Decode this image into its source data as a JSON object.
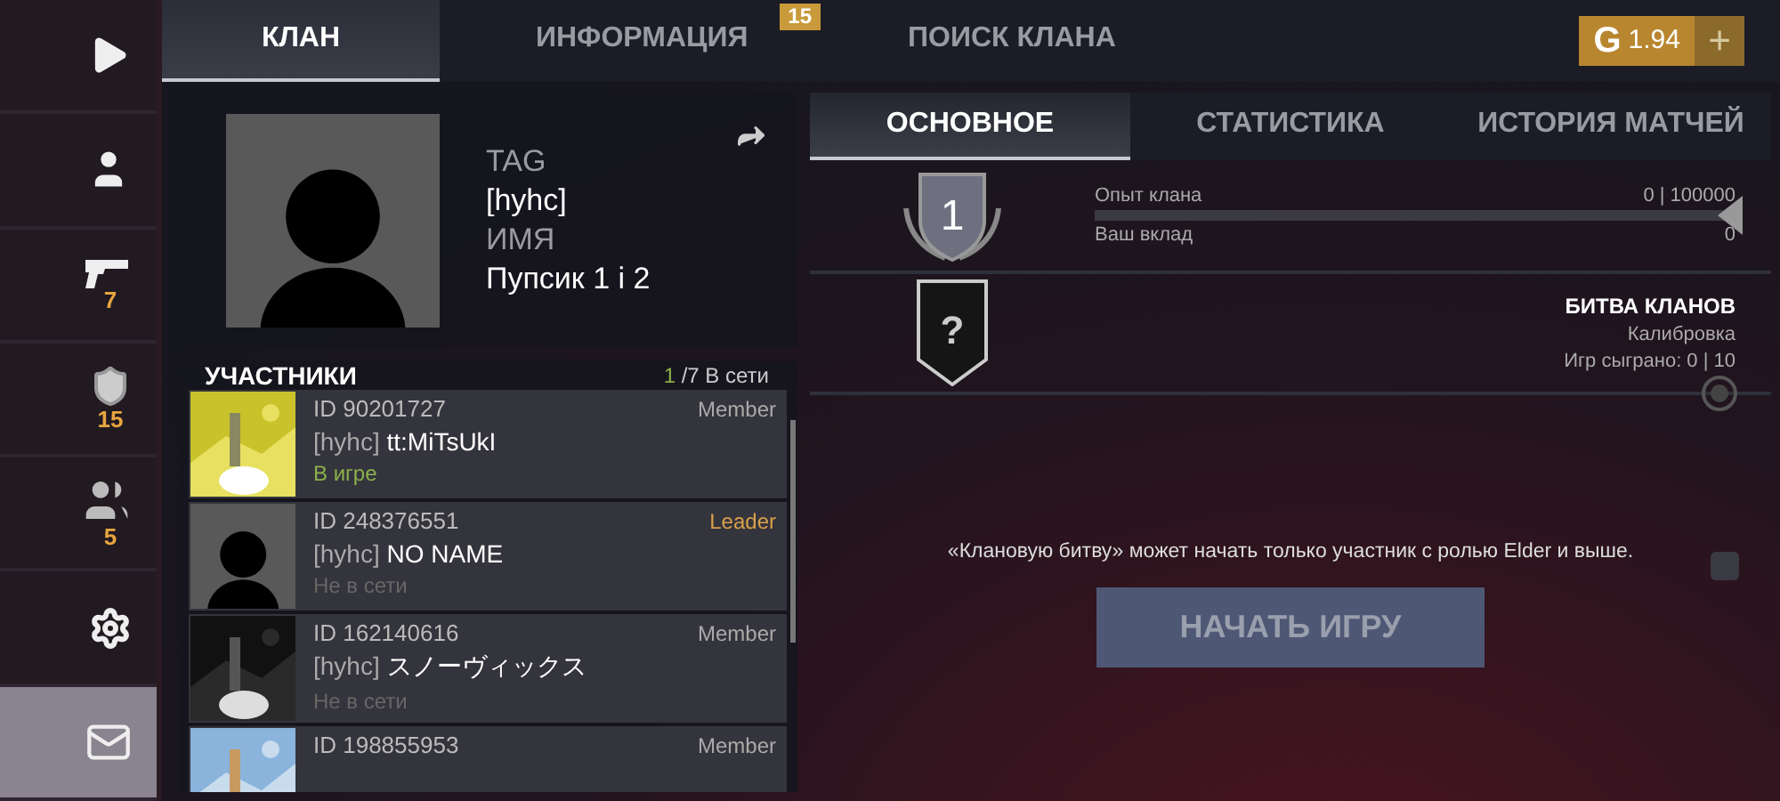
{
  "sidebar": {
    "items": [
      {
        "kind": "play",
        "selected": false
      },
      {
        "kind": "profile",
        "selected": false
      },
      {
        "kind": "pistol",
        "count": "7",
        "selected": false
      },
      {
        "kind": "shield",
        "count": "15",
        "selected": false
      },
      {
        "kind": "group",
        "count": "5",
        "selected": false
      },
      {
        "kind": "settings",
        "selected": false
      },
      {
        "kind": "mail",
        "selected": true
      }
    ]
  },
  "tabs": [
    {
      "label": "КЛАН",
      "selected": true
    },
    {
      "label": "ИНФОРМАЦИЯ",
      "selected": false,
      "badge": "15"
    },
    {
      "label": "ПОИСК КЛАНА",
      "selected": false
    }
  ],
  "currency": {
    "symbol": "G",
    "amount": "1.94",
    "add": "+"
  },
  "clan": {
    "tag_label": "TAG",
    "tag": "[hyhc]",
    "name_label": "ИМЯ",
    "name": "Пупсик 1 i 2"
  },
  "members": {
    "title": "УЧАСТНИКИ",
    "online": "1",
    "total": "/7 В сети",
    "rows": [
      {
        "kind": "picture",
        "id": "ID 90201727",
        "tag": "[hyhc]",
        "name": "tt:MiTsUkI",
        "status": "В игре",
        "in_game": true,
        "role": "Member",
        "leader": false
      },
      {
        "kind": "silhouette",
        "id": "ID 248376551",
        "tag": "[hyhc]",
        "name": "NO NAME",
        "status": "Не в сети",
        "in_game": false,
        "role": "Leader",
        "leader": true
      },
      {
        "kind": "picture",
        "id": "ID 162140616",
        "tag": "[hyhc]",
        "name": "スノーヴィックス",
        "status": "Не в сети",
        "in_game": false,
        "role": "Member",
        "leader": false
      },
      {
        "kind": "picture",
        "id": "ID 198855953",
        "role": "Member",
        "leader": false
      }
    ]
  },
  "subtabs": [
    {
      "label": "ОСНОВНОЕ",
      "selected": true
    },
    {
      "label": "СТАТИСТИКА",
      "selected": false
    },
    {
      "label": "ИСТОРИЯ МАТЧЕЙ",
      "selected": false
    }
  ],
  "rank": {
    "level": "1",
    "xp_label": "Опыт клана",
    "xp_value": "0 | 100000",
    "contribution_label": "Ваш вклад",
    "contribution_value": "0"
  },
  "battle": {
    "badge": "?",
    "title": "БИТВА КЛАНОВ",
    "status": "Калибровка",
    "games": "Игр сыграно: 0 | 10"
  },
  "notice": "«Клановую битву» может начать только участник с ролью Elder и выше.",
  "start_button": {
    "label": "НАЧАТЬ ИГРУ",
    "disabled": true
  }
}
